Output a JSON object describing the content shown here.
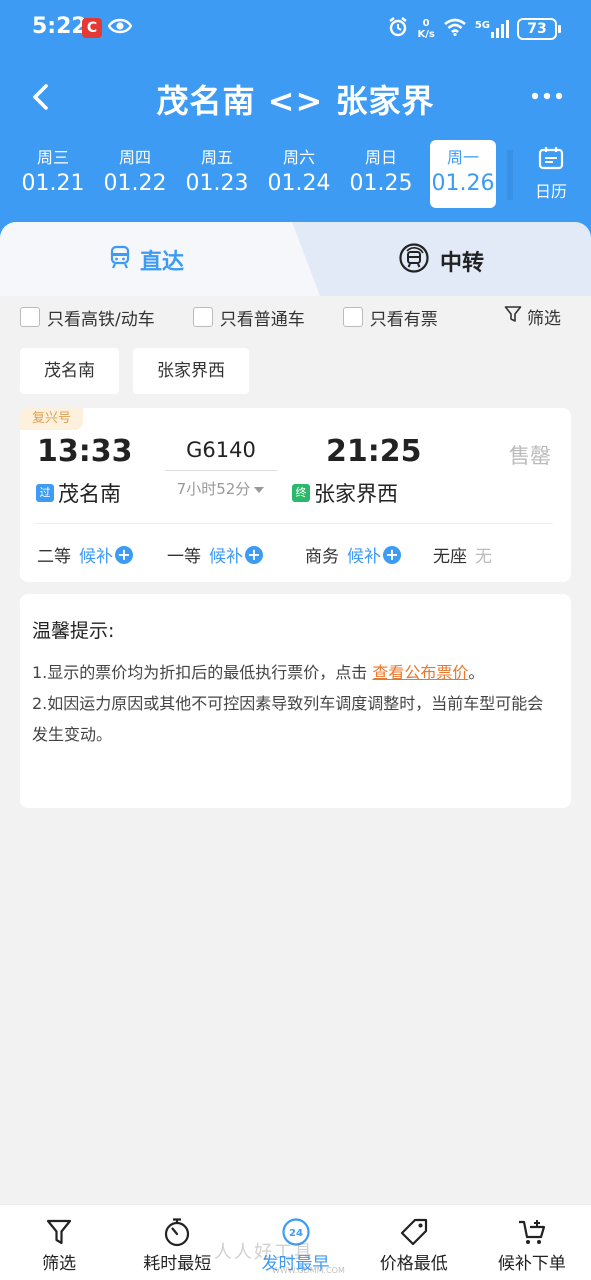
{
  "status_bar": {
    "time": "5:22",
    "net_speed_value": "0",
    "net_speed_unit": "K/s",
    "network": "5G",
    "battery": "73"
  },
  "nav": {
    "title": "茂名南 <> 张家界"
  },
  "dates": [
    {
      "weekday": "周三",
      "date": "01.21",
      "active": false
    },
    {
      "weekday": "周四",
      "date": "01.22",
      "active": false
    },
    {
      "weekday": "周五",
      "date": "01.23",
      "active": false
    },
    {
      "weekday": "周六",
      "date": "01.24",
      "active": false
    },
    {
      "weekday": "周日",
      "date": "01.25",
      "active": false
    },
    {
      "weekday": "周一",
      "date": "01.26",
      "active": true
    }
  ],
  "calendar_label": "日历",
  "tabs": {
    "direct": "直达",
    "transfer": "中转"
  },
  "filters": {
    "high_speed": "只看高铁/动车",
    "normal": "只看普通车",
    "available": "只看有票",
    "filter": "筛选"
  },
  "stations": [
    "茂名南",
    "张家界西"
  ],
  "train": {
    "badge": "复兴号",
    "dep_time": "13:33",
    "arr_time": "21:25",
    "number": "G6140",
    "duration": "7小时52分",
    "dep_tag": "过",
    "dep_station": "茂名南",
    "arr_tag": "终",
    "arr_station": "张家界西",
    "status": "售罄",
    "seats": [
      {
        "name": "二等",
        "value": "候补"
      },
      {
        "name": "一等",
        "value": "候补"
      },
      {
        "name": "商务",
        "value": "候补"
      },
      {
        "name": "无座",
        "value": "无"
      }
    ]
  },
  "tips": {
    "title": "温馨提示:",
    "line1_prefix": "1.显示的票价均为折扣后的最低执行票价，点击 ",
    "line1_link": "查看公布票价",
    "line1_suffix": "。",
    "line2": "2.如因运力原因或其他不可控因素导致列车调度调整时，当前车型可能会发生变动。"
  },
  "bottom_bar": [
    {
      "label": "筛选",
      "icon": "filter-icon",
      "active": false
    },
    {
      "label": "耗时最短",
      "icon": "timer-icon",
      "active": false
    },
    {
      "label": "发时最早",
      "icon": "clock-24-icon",
      "active": true
    },
    {
      "label": "价格最低",
      "icon": "price-tag-icon",
      "active": false
    },
    {
      "label": "候补下单",
      "icon": "cart-plus-icon",
      "active": false
    }
  ],
  "watermark": {
    "text": "人人好工具",
    "url": "WWW.GDMM.COM"
  },
  "colors": {
    "primary": "#3d9bf4",
    "link": "#e8792d",
    "badge_bg": "#fdf0dc",
    "badge_text": "#d9a157",
    "terminal_tag": "#2cb86a"
  }
}
